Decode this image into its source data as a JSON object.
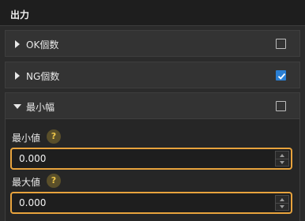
{
  "panel": {
    "title": "出力"
  },
  "sections": [
    {
      "label": "OK個数",
      "expanded": false,
      "checked": false
    },
    {
      "label": "NG個数",
      "expanded": false,
      "checked": true
    },
    {
      "label": "最小幅",
      "expanded": true,
      "checked": false
    }
  ],
  "fields": [
    {
      "label": "最小値",
      "help": "?",
      "value": "0.000"
    },
    {
      "label": "最大値",
      "help": "?",
      "value": "0.000"
    }
  ],
  "colors": {
    "accent_focus": "#e8a33d",
    "checkbox_checked": "#2a7fd4",
    "help_icon": "#f0c84a"
  }
}
